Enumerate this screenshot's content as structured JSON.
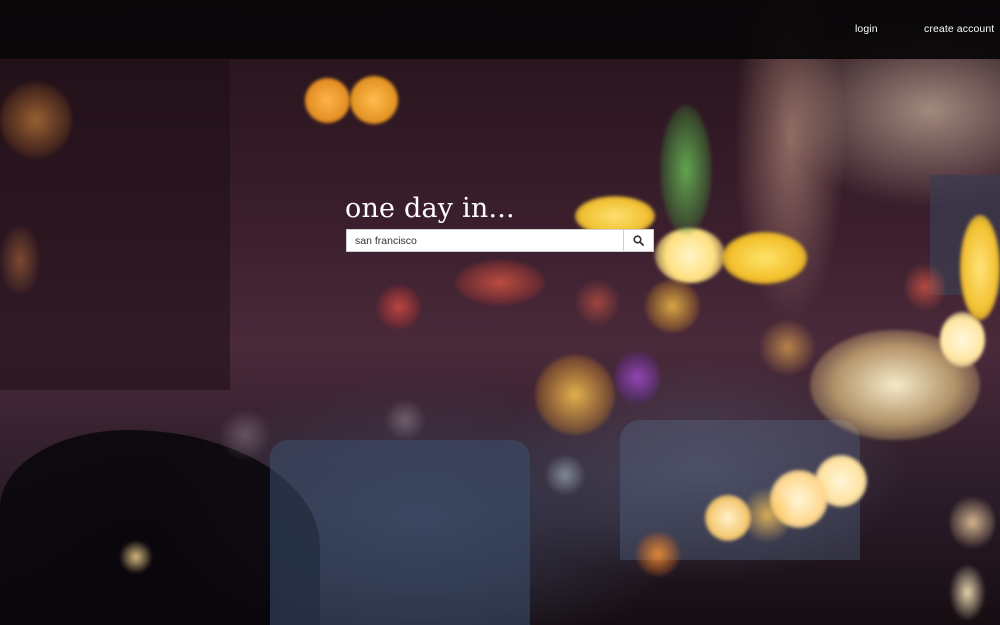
{
  "nav": {
    "login_label": "login",
    "create_account_label": "create account"
  },
  "hero": {
    "title": "one day in...",
    "search_value": "san francisco",
    "search_icon": "search-icon"
  },
  "colors": {
    "topbar": "#080607",
    "text": "#ffffff",
    "input_bg": "#ffffff"
  }
}
